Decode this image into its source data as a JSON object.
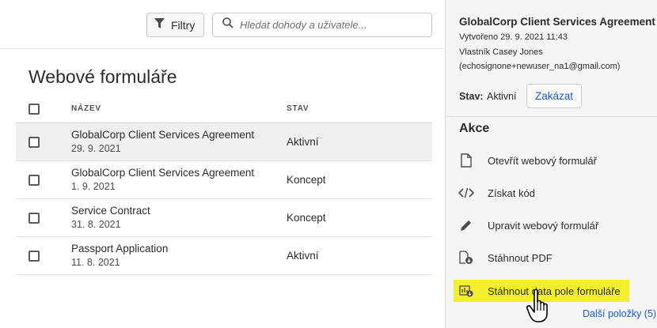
{
  "toolbar": {
    "filter_label": "Filtry",
    "search_placeholder": "Hledat dohody a uživatele..."
  },
  "main": {
    "title": "Webové formuláře",
    "columns": {
      "name": "NÁZEV",
      "status": "STAV"
    },
    "rows": [
      {
        "name": "GlobalCorp Client Services Agreement",
        "date": "29. 9. 2021",
        "status": "Aktivní",
        "selected": true
      },
      {
        "name": "GlobalCorp Client Services Agreement",
        "date": "1. 9. 2021",
        "status": "Koncept",
        "selected": false
      },
      {
        "name": "Service Contract",
        "date": "31. 8. 2021",
        "status": "Koncept",
        "selected": false
      },
      {
        "name": "Passport Application",
        "date": "11. 8. 2021",
        "status": "Aktivní",
        "selected": false
      }
    ]
  },
  "panel": {
    "title": "GlobalCorp Client Services Agreement",
    "created": "Vytvořeno 29. 9. 2021 11:43",
    "owner": "Vlastník Casey Jones",
    "email": "(echosignone+newuser_na1@gmail.com)",
    "state_label": "Stav:",
    "state_value": "Aktivní",
    "disable_label": "Zakázat",
    "actions_title": "Akce",
    "actions": [
      {
        "label": "Otevřít webový formulář",
        "icon": "document-icon"
      },
      {
        "label": "Získat kód",
        "icon": "code-icon"
      },
      {
        "label": "Upravit webový formulář",
        "icon": "pencil-icon"
      },
      {
        "label": "Stáhnout PDF",
        "icon": "pdf-download-icon"
      },
      {
        "label": "Stáhnout data pole formuláře",
        "icon": "data-download-icon"
      }
    ],
    "more_label": "Další položky (5)",
    "highlight_color": "#f3ef2e",
    "link_color": "#1a5dc8"
  }
}
